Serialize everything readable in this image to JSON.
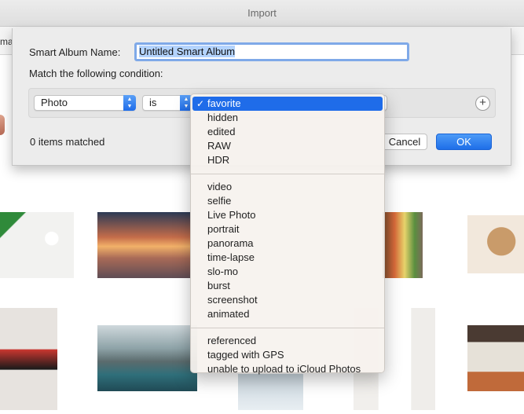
{
  "window": {
    "title": "Import",
    "toolbar_cut_label": "ma"
  },
  "dialog": {
    "name_label": "Smart Album Name:",
    "name_value": "Untitled Smart Album",
    "condition_label": "Match the following condition:",
    "field_popup": "Photo",
    "operator_popup": "is",
    "add_condition_icon": "plus-circle-icon",
    "matched_text": "0 items matched",
    "cancel_label": "Cancel",
    "ok_label": "OK"
  },
  "menu": {
    "selected": "favorite",
    "group1": [
      "favorite",
      "hidden",
      "edited",
      "RAW",
      "HDR"
    ],
    "group2": [
      "video",
      "selfie",
      "Live Photo",
      "portrait",
      "panorama",
      "time-lapse",
      "slo-mo",
      "burst",
      "screenshot",
      "animated"
    ],
    "group3": [
      "referenced",
      "tagged with GPS",
      "unable to upload to iCloud Photos"
    ]
  },
  "colors": {
    "accent": "#1f6ce9",
    "field_focus": "#7fa9e8",
    "selection": "#b3d3fd"
  }
}
